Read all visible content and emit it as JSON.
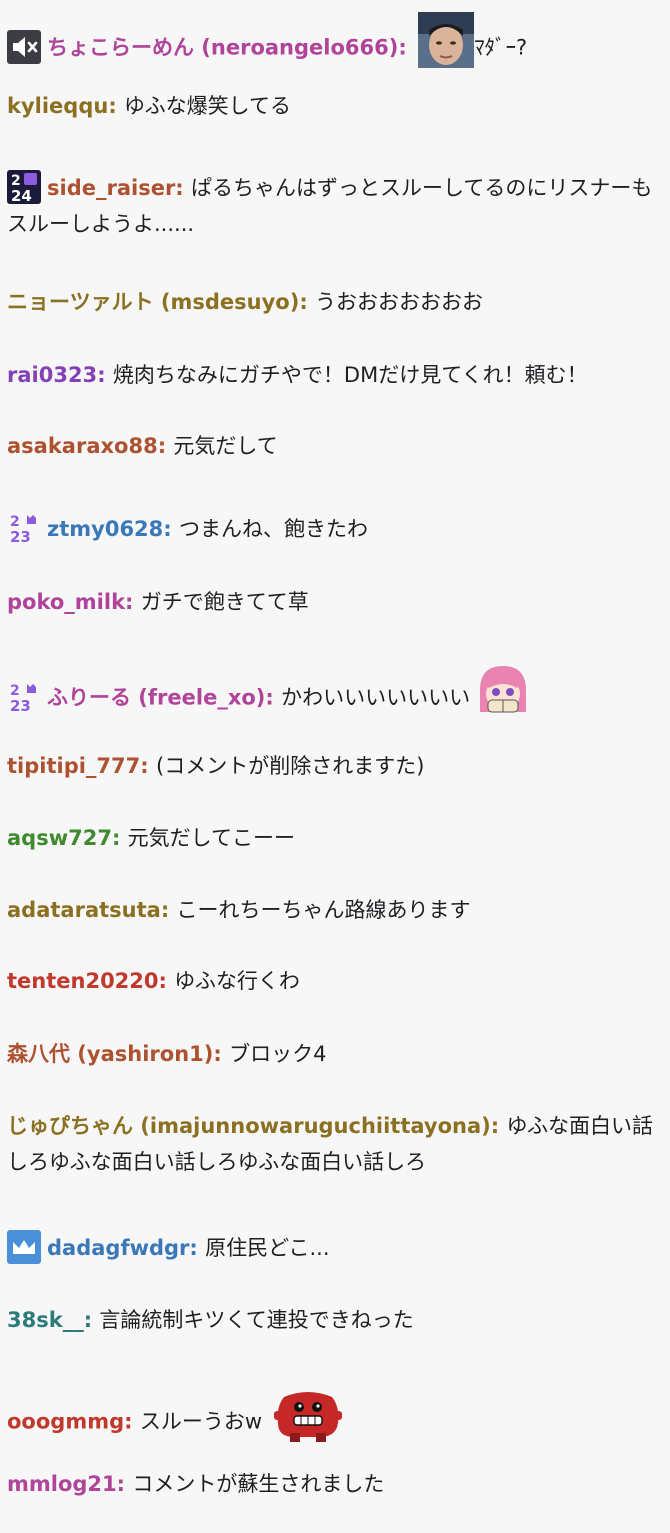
{
  "messages": [
    {
      "username": "ちょこらーめん (neroangelo666)",
      "color": "#b0449a",
      "badge": "mute",
      "text": "ﾏﾀﾞｰ?",
      "emote": "face-photo"
    },
    {
      "username": "kylieqqu",
      "color": "#8c7022",
      "text": "ゆふな爆笑してる"
    },
    {
      "username": "side_raiser",
      "color": "#ad5231",
      "badge": "2024",
      "text": "ぱるちゃんはずっとスルーしてるのにリスナーもスルーしようよ......"
    },
    {
      "username": "ニョーツァルト (msdesuyo)",
      "color": "#8c7022",
      "text": "うおおおおおおお"
    },
    {
      "username": "rai0323",
      "color": "#8440b5",
      "text": "焼肉ちなみにガチやで！DMだけ見てくれ！頼む！"
    },
    {
      "username": "asakaraxo88",
      "color": "#ad5231",
      "text": "元気だして"
    },
    {
      "username": "ztmy0628",
      "color": "#3a78b8",
      "badge": "2023",
      "text": "つまんね、飽きたわ"
    },
    {
      "username": "poko_milk",
      "color": "#b0449a",
      "text": "ガチで飽きてて草"
    },
    {
      "username": "ふりーる (freele_xo)",
      "color": "#b0449a",
      "badge": "2023",
      "text": "かわいいいいいいい",
      "emote": "anime-girl"
    },
    {
      "username": "tipitipi_777",
      "color": "#ad5231",
      "text": "(コメントが削除されますた)"
    },
    {
      "username": "aqsw727",
      "color": "#3e8a2e",
      "text": "元気だしてこーー"
    },
    {
      "username": "adataratsuta",
      "color": "#8c7022",
      "text": "こーれちーちゃん路線あります"
    },
    {
      "username": "tenten20220",
      "color": "#c0392b",
      "text": "ゆふな行くわ"
    },
    {
      "username": "森八代 (yashiron1)",
      "color": "#ad5231",
      "text": "ブロック4"
    },
    {
      "username": "じゅぴちゃん (imajunnowaruguchiittayona)",
      "color": "#8c7022",
      "text": "ゆふな面白い話しろゆふな面白い話しろゆふな面白い話しろ"
    },
    {
      "username": "dadagfwdgr",
      "color": "#3a78b8",
      "badge": "crown",
      "text": "原住民どこ..."
    },
    {
      "username": "38sk__",
      "color": "#2d7a7a",
      "text": "言論統制キツくて連投できねった"
    },
    {
      "username": "ooogmmg",
      "color": "#c0392b",
      "text": "スルーうおw",
      "emote": "meat-boy"
    },
    {
      "username": "mmlog21",
      "color": "#b0449a",
      "text": "コメントが蘇生されました"
    }
  ]
}
